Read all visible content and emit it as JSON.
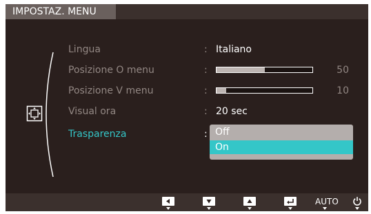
{
  "menu": {
    "title": "IMPOSTAZ. MENU",
    "items": [
      {
        "label": "Lingua",
        "value": "Italiano"
      },
      {
        "label": "Posizione O menu",
        "slider": 50
      },
      {
        "label": "Posizione V menu",
        "slider": 10
      },
      {
        "label": "Visual ora",
        "value": "20 sec"
      },
      {
        "label": "Trasparenza"
      }
    ],
    "colon": ":",
    "dropdown": {
      "options": [
        "Off",
        "On"
      ],
      "selected": "On"
    }
  },
  "footer": {
    "auto_label": "AUTO",
    "icons": [
      "left-arrow-icon",
      "down-arrow-icon",
      "up-arrow-icon",
      "enter-icon",
      "auto-button",
      "power-icon"
    ]
  },
  "colors": {
    "background": "#2a1f1d",
    "accent": "#34c6c8",
    "inactive_text": "#928783",
    "dropdown": "#b4aeac"
  },
  "side_icon": "osd-position-icon"
}
